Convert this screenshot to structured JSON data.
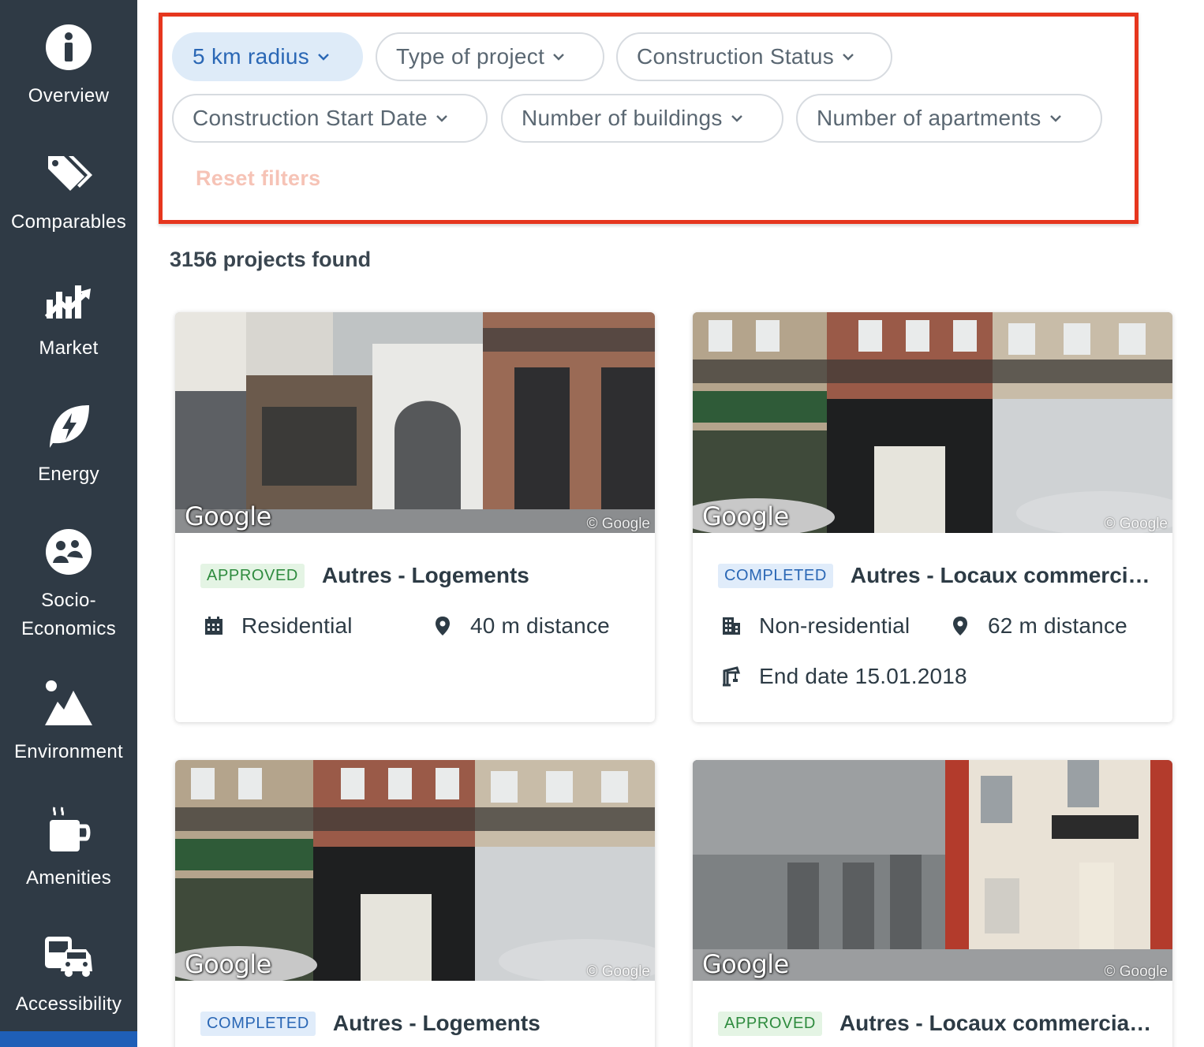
{
  "sidebar": {
    "items": [
      {
        "label": "Overview",
        "icon": "info-icon"
      },
      {
        "label": "Comparables",
        "icon": "tags-icon"
      },
      {
        "label": "Market",
        "icon": "chart-trend-icon"
      },
      {
        "label": "Energy",
        "icon": "leaf-bolt-icon"
      },
      {
        "label": "Socio-\nEconomics",
        "icon": "people-icon"
      },
      {
        "label": "Environment",
        "icon": "mountain-icon"
      },
      {
        "label": "Amenities",
        "icon": "coffee-icon"
      },
      {
        "label": "Accessibility",
        "icon": "transit-icon"
      }
    ]
  },
  "filters": {
    "chips": [
      {
        "label": "5 km radius",
        "active": true
      },
      {
        "label": "Type of project"
      },
      {
        "label": "Construction Status"
      },
      {
        "label": "Construction Start Date"
      },
      {
        "label": "Number of buildings"
      },
      {
        "label": "Number of apartments"
      }
    ],
    "reset_label": "Reset filters"
  },
  "results": {
    "count_text": "3156 projects found"
  },
  "cards": [
    {
      "status": "APPROVED",
      "title": "Autres - Logements",
      "type": "Residential",
      "distance": "40 m distance",
      "google": "Google",
      "copyright": "© Google"
    },
    {
      "status": "COMPLETED",
      "title": "Autres - Locaux commercia...",
      "type": "Non-residential",
      "distance": "62 m distance",
      "end_date": "End date 15.01.2018",
      "google": "Google",
      "copyright": "© Google"
    },
    {
      "status": "COMPLETED",
      "title": "Autres - Logements",
      "google": "Google",
      "copyright": "© Google"
    },
    {
      "status": "APPROVED",
      "title": "Autres - Locaux commerciaux",
      "google": "Google",
      "copyright": "© Google"
    }
  ],
  "colors": {
    "sidebar_bg": "#2f3a45",
    "highlight_border": "#e6361e",
    "active_chip_bg": "#deebf8",
    "active_chip_text": "#2a67b5",
    "approved": "#2e8b3e",
    "completed": "#2a67b5",
    "reset_text": "#f6c3b6"
  }
}
